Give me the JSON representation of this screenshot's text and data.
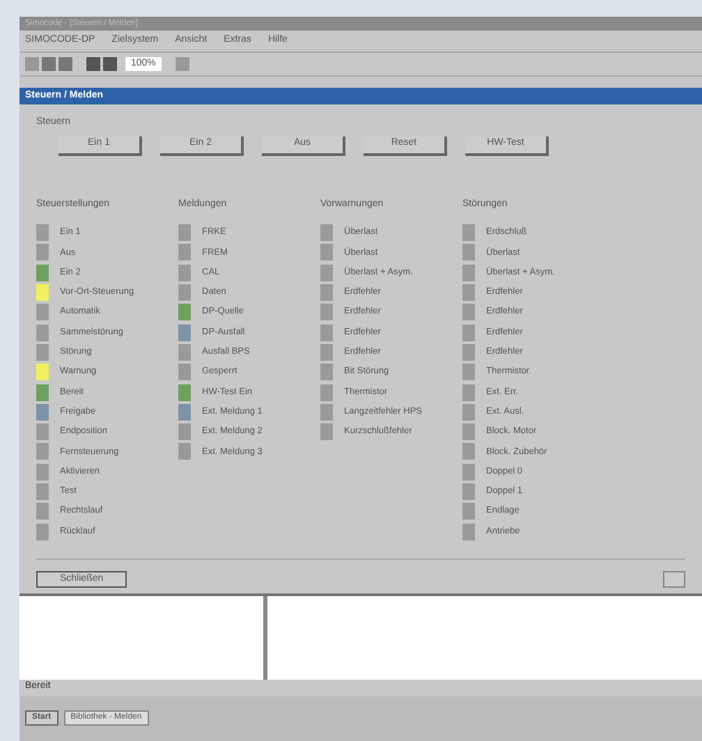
{
  "window": {
    "title": "Simocode - [Steuern / Melden]"
  },
  "menu": [
    "SIMOCODE-DP",
    "Zielsystem",
    "Ansicht",
    "Extras",
    "Hilfe"
  ],
  "toolbar": {
    "zoom": "100%"
  },
  "panel": {
    "title": "Steuern / Melden",
    "control_group": {
      "label": "Steuern",
      "buttons": [
        "Ein 1",
        "Ein 2",
        "Aus",
        "Reset",
        "HW-Test"
      ]
    },
    "columns": [
      {
        "heading": "Steuerstellungen",
        "items": [
          {
            "label": "Ein 1",
            "color": "#9a9a9a"
          },
          {
            "label": "Aus",
            "color": "#9a9a9a"
          },
          {
            "label": "Ein 2",
            "color": "#6fa060"
          },
          {
            "label": "Vor-Ort-Steuerung",
            "color": "#f0f060"
          },
          {
            "label": "Automatik",
            "color": "#9a9a9a"
          },
          {
            "label": "Sammelstörung",
            "color": "#9a9a9a"
          },
          {
            "label": "Störung",
            "color": "#9a9a9a"
          },
          {
            "label": "Warnung",
            "color": "#f0f060"
          },
          {
            "label": "Bereit",
            "color": "#6fa060"
          },
          {
            "label": "Freigabe",
            "color": "#7f93a8"
          },
          {
            "label": "Endposition",
            "color": "#9a9a9a"
          },
          {
            "label": "Fernsteuerung",
            "color": "#9a9a9a"
          },
          {
            "label": "Aktivieren",
            "color": "#9a9a9a"
          },
          {
            "label": "Test",
            "color": "#9a9a9a"
          },
          {
            "label": "Rechtslauf",
            "color": "#9a9a9a"
          },
          {
            "label": "Rücklauf",
            "color": "#9a9a9a"
          }
        ]
      },
      {
        "heading": "Meldungen",
        "items": [
          {
            "label": "FRKE",
            "color": "#9a9a9a"
          },
          {
            "label": "FREM",
            "color": "#9a9a9a"
          },
          {
            "label": "CAL",
            "color": "#9a9a9a"
          },
          {
            "label": "Daten",
            "color": "#9a9a9a"
          },
          {
            "label": "DP-Quelle",
            "color": "#6fa060"
          },
          {
            "label": "DP-Ausfall",
            "color": "#7f93a8"
          },
          {
            "label": "Ausfall BPS",
            "color": "#9a9a9a"
          },
          {
            "label": "Gesperrt",
            "color": "#9a9a9a"
          },
          {
            "label": "HW-Test Ein",
            "color": "#6fa060"
          },
          {
            "label": "Ext. Meldung 1",
            "color": "#7f93a8"
          },
          {
            "label": "Ext. Meldung 2",
            "color": "#9a9a9a"
          },
          {
            "label": "Ext. Meldung 3",
            "color": "#9a9a9a"
          }
        ]
      },
      {
        "heading": "Vorwarnungen",
        "items": [
          {
            "label": "Überlast",
            "color": "#9a9a9a"
          },
          {
            "label": "Überlast",
            "color": "#9a9a9a"
          },
          {
            "label": "Überlast + Asym.",
            "color": "#9a9a9a"
          },
          {
            "label": "Erdfehler",
            "color": "#9a9a9a"
          },
          {
            "label": "Erdfehler",
            "color": "#9a9a9a"
          },
          {
            "label": "Erdfehler",
            "color": "#9a9a9a"
          },
          {
            "label": "Erdfehler",
            "color": "#9a9a9a"
          },
          {
            "label": "Bit Störung",
            "color": "#9a9a9a"
          },
          {
            "label": "Thermistor",
            "color": "#9a9a9a"
          },
          {
            "label": "Langzeitfehler HPS",
            "color": "#9a9a9a"
          },
          {
            "label": "Kurzschlußfehler",
            "color": "#9a9a9a"
          }
        ]
      },
      {
        "heading": "Störungen",
        "items": [
          {
            "label": "Erdschluß",
            "color": "#9a9a9a"
          },
          {
            "label": "Überlast",
            "color": "#9a9a9a"
          },
          {
            "label": "Überlast + Asym.",
            "color": "#9a9a9a"
          },
          {
            "label": "Erdfehler",
            "color": "#9a9a9a"
          },
          {
            "label": "Erdfehler",
            "color": "#9a9a9a"
          },
          {
            "label": "Erdfehler",
            "color": "#9a9a9a"
          },
          {
            "label": "Erdfehler",
            "color": "#9a9a9a"
          },
          {
            "label": "Thermistor",
            "color": "#9a9a9a"
          },
          {
            "label": "Ext. Err.",
            "color": "#9a9a9a"
          },
          {
            "label": "Ext. Ausl.",
            "color": "#9a9a9a"
          },
          {
            "label": "Block. Motor",
            "color": "#9a9a9a"
          },
          {
            "label": "Block. Zubehör",
            "color": "#9a9a9a"
          },
          {
            "label": "Doppel 0",
            "color": "#9a9a9a"
          },
          {
            "label": "Doppel 1",
            "color": "#9a9a9a"
          },
          {
            "label": "Endlage",
            "color": "#9a9a9a"
          },
          {
            "label": "Antriebe",
            "color": "#9a9a9a"
          }
        ]
      }
    ],
    "close_button": "Schließen"
  },
  "status_bar": "Bereit",
  "taskbar": {
    "start": "Start",
    "tasks": [
      "Bibliothek - Melden"
    ]
  }
}
